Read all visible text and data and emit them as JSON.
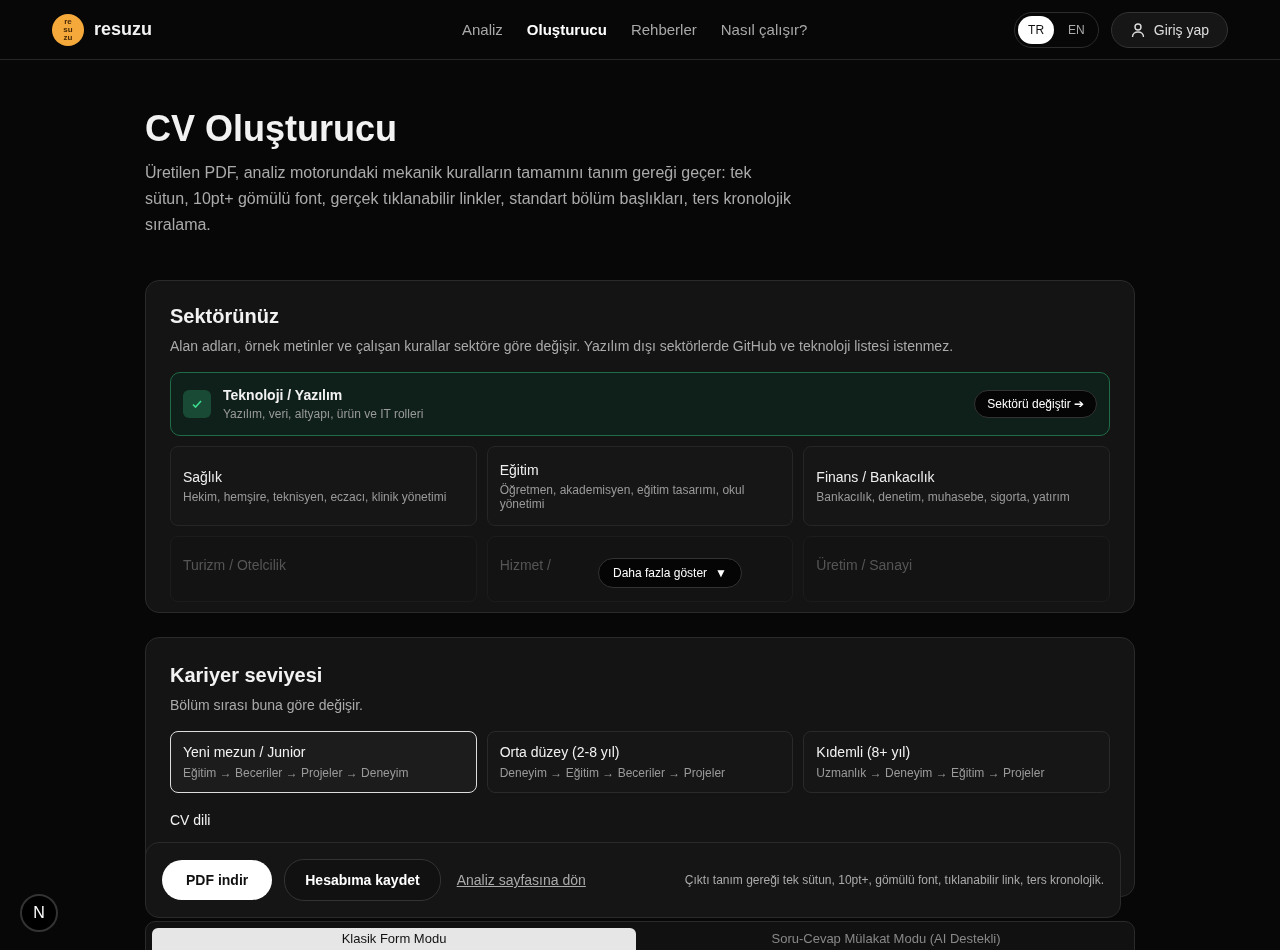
{
  "header": {
    "logo_letters": [
      "re",
      "su",
      "zu"
    ],
    "brand": "resuzu",
    "nav": [
      {
        "label": "Analiz",
        "selected": false
      },
      {
        "label": "Oluşturucu",
        "selected": true
      },
      {
        "label": "Rehberler",
        "selected": false
      },
      {
        "label": "Nasıl çalışır?",
        "selected": false
      }
    ],
    "languages": [
      {
        "label": "TR",
        "selected": true
      },
      {
        "label": "EN",
        "selected": false
      }
    ],
    "login": "Giriş yap"
  },
  "page": {
    "title": "CV Oluşturucu",
    "intro": "Üretilen PDF, analiz motorundaki mekanik kuralların tamamını tanım gereği geçer: tek sütun, 10pt+ gömülü font, gerçek tıklanabilir linkler, standart bölüm başlıkları, ters kronolojik sıralama."
  },
  "sector": {
    "title": "Sektörünüz",
    "description": "Alan adları, örnek metinler ve çalışan kurallar sektöre göre değişir. Yazılım dışı sektörlerde GitHub ve teknoloji listesi istenmez.",
    "current": {
      "name": "Teknoloji / Yazılım",
      "detail": "Yazılım, veri, altyapı, ürün ve IT rolleri",
      "checked": true,
      "change": "Sektörü değiştir ➔"
    },
    "options": [
      {
        "name": "Sağlık",
        "detail": "Hekim, hemşire, teknisyen, eczacı, klinik yönetimi",
        "faded": false
      },
      {
        "name": "Eğitim",
        "detail": "Öğretmen, akademisyen, eğitim tasarımı, okul yönetimi",
        "faded": false
      },
      {
        "name": "Finans / Bankacılık",
        "detail": "Bankacılık, denetim, muhasebe, sigorta, yatırım",
        "faded": false
      },
      {
        "name": "Turizm / Otelcilik",
        "faded": true
      },
      {
        "name": "Hizmet /",
        "faded": true
      },
      {
        "name": "Üretim / Sanayi",
        "faded": true
      }
    ],
    "more": "Daha fazla göster",
    "more_icon": "▼"
  },
  "career": {
    "title": "Kariyer seviyesi",
    "description": "Bölüm sırası buna göre değişir.",
    "levels": [
      {
        "name": "Yeni mezun / Junior",
        "order": "Eğitim → Beceriler → Projeler → Deneyim",
        "selected": true
      },
      {
        "name": "Orta düzey (2-8 yıl)",
        "order": "Deneyim → Eğitim → Beceriler → Projeler",
        "selected": false
      },
      {
        "name": "Kıdemli (8+ yıl)",
        "order": "Uzmanlık → Deneyim → Eğitim → Projeler",
        "selected": false
      }
    ],
    "language_label": "CV dili"
  },
  "actions": {
    "download": "PDF indir",
    "save": "Hesabıma kaydet",
    "back": "Analiz sayfasına dön",
    "note": "Çıktı tanım gereği tek sütun, 10pt+, gömülü font, tıklanabilir link, ters kronolojik."
  },
  "modes": [
    {
      "label": "Klasik Form Modu",
      "selected": true
    },
    {
      "label": "Soru-Cevap Mülakat Modu (AI Destekli)",
      "selected": false
    }
  ],
  "dev_badge": "N"
}
